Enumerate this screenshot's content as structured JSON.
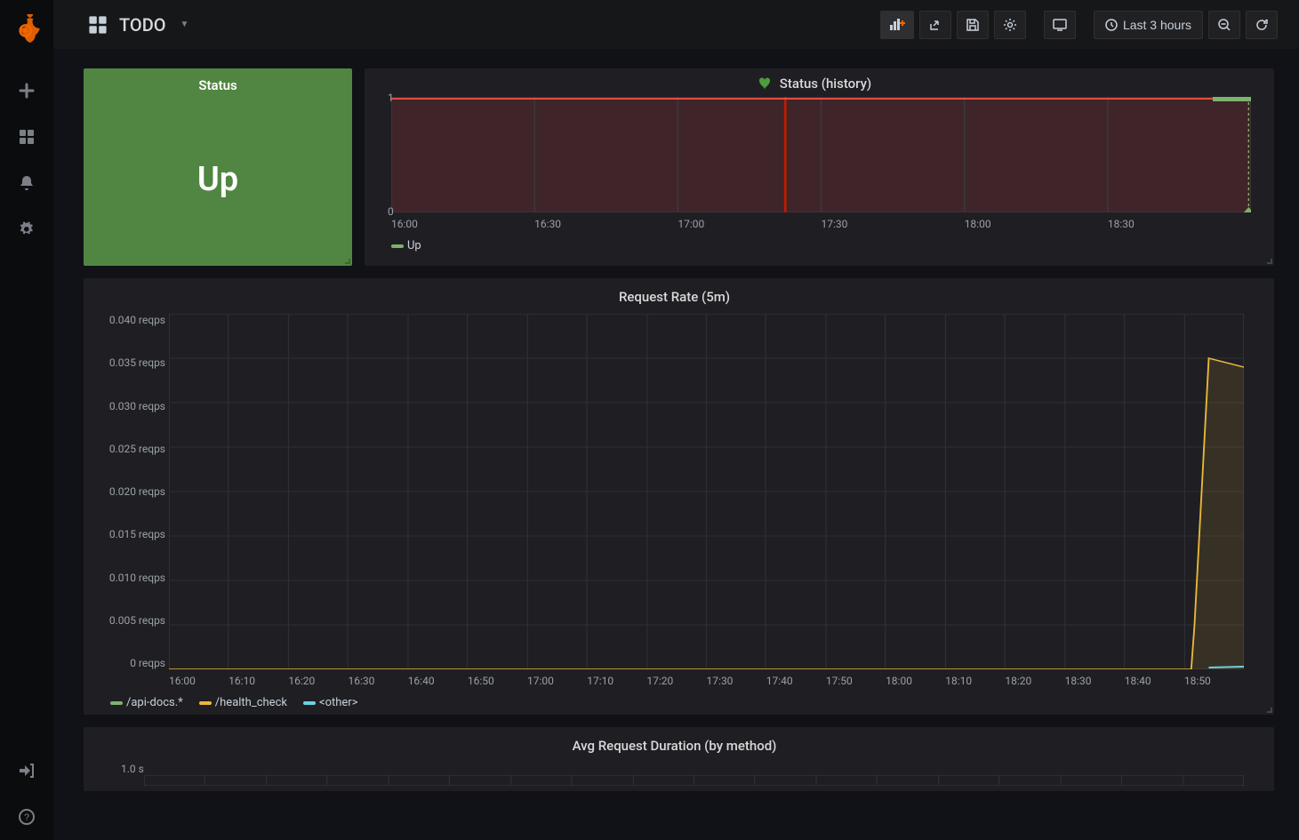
{
  "header": {
    "dashboard_title": "TODO",
    "time_range_label": "Last 3 hours"
  },
  "sidebar": {
    "items": [
      "add",
      "dashboards",
      "alerts",
      "settings",
      "signin",
      "help"
    ]
  },
  "panels": {
    "status": {
      "title": "Status",
      "value": "Up",
      "color": "#508642"
    },
    "history": {
      "title": "Status (history)",
      "legend": [
        {
          "label": "Up",
          "color": "#7EB26D"
        }
      ],
      "x_ticks": [
        "16:00",
        "16:30",
        "17:00",
        "17:30",
        "18:00",
        "18:30"
      ],
      "y_ticks": [
        "1",
        "0"
      ]
    },
    "request_rate": {
      "title": "Request Rate (5m)",
      "y_ticks": [
        "0.040 reqps",
        "0.035 reqps",
        "0.030 reqps",
        "0.025 reqps",
        "0.020 reqps",
        "0.015 reqps",
        "0.010 reqps",
        "0.005 reqps",
        "0 reqps"
      ],
      "x_ticks": [
        "16:00",
        "16:10",
        "16:20",
        "16:30",
        "16:40",
        "16:50",
        "17:00",
        "17:10",
        "17:20",
        "17:30",
        "17:40",
        "17:50",
        "18:00",
        "18:10",
        "18:20",
        "18:30",
        "18:40",
        "18:50"
      ],
      "legend": [
        {
          "label": "/api-docs.*",
          "color": "#7EB26D"
        },
        {
          "label": "/health_check",
          "color": "#EAB839"
        },
        {
          "label": "<other>",
          "color": "#6ED0E0"
        }
      ]
    },
    "avg_duration": {
      "title": "Avg Request Duration (by method)",
      "y_tick_top": "1.0 s"
    }
  },
  "chart_data": [
    {
      "type": "line",
      "title": "Status (history)",
      "xlabel": "",
      "ylabel": "",
      "x_range_ticks": [
        "16:00",
        "16:30",
        "17:00",
        "17:30",
        "18:00",
        "18:30"
      ],
      "ylim": [
        0,
        1
      ],
      "series": [
        {
          "name": "Up",
          "color": "#7EB26D",
          "values_constant": 1,
          "x_from": "16:00",
          "x_to": "18:55",
          "note": "thick green segment only at far right ~18:52-18:55"
        }
      ],
      "overlay": "solid red fill at y=1 across full range"
    },
    {
      "type": "line",
      "title": "Request Rate (5m)",
      "xlabel": "",
      "ylabel": "reqps",
      "ylim": [
        0,
        0.04
      ],
      "x": [
        "16:00",
        "16:10",
        "16:20",
        "16:30",
        "16:40",
        "16:50",
        "17:00",
        "17:10",
        "17:20",
        "17:30",
        "17:40",
        "17:50",
        "18:00",
        "18:10",
        "18:20",
        "18:30",
        "18:40",
        "18:45",
        "18:50",
        "18:55"
      ],
      "series": [
        {
          "name": "/api-docs.*",
          "color": "#7EB26D",
          "values": [
            0,
            0,
            0,
            0,
            0,
            0,
            0,
            0,
            0,
            0,
            0,
            0,
            0,
            0,
            0,
            0,
            0,
            0,
            0,
            0
          ]
        },
        {
          "name": "/health_check",
          "color": "#EAB839",
          "values": [
            0,
            0,
            0,
            0,
            0,
            0,
            0,
            0,
            0,
            0,
            0,
            0,
            0,
            0,
            0,
            0,
            0,
            0.005,
            0.035,
            0.034
          ]
        },
        {
          "name": "<other>",
          "color": "#6ED0E0",
          "values": [
            0,
            0,
            0,
            0,
            0,
            0,
            0,
            0,
            0,
            0,
            0,
            0,
            0,
            0,
            0,
            0,
            0,
            0,
            0.001,
            0.001
          ]
        }
      ]
    },
    {
      "type": "line",
      "title": "Avg Request Duration (by method)",
      "ylabel": "s",
      "ylim_top_visible": 1.0,
      "note": "panel only partially visible; top y-tick 1.0 s shown"
    }
  ]
}
